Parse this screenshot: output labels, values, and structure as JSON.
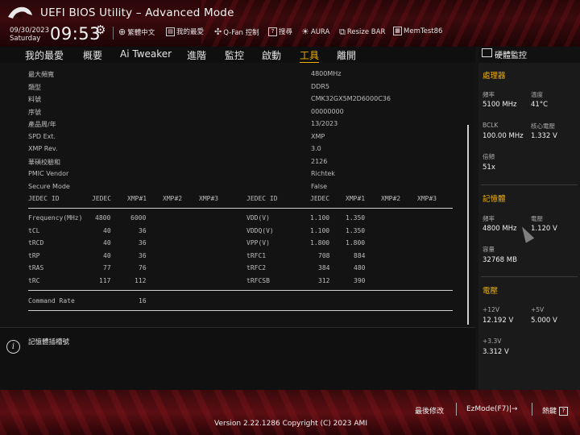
{
  "header": {
    "title": "UEFI BIOS Utility – Advanced Mode",
    "date": "09/30/2023",
    "weekday": "Saturday",
    "time": "09:53",
    "toolbar": [
      {
        "label": "繁體中文",
        "icon": "globe-icon"
      },
      {
        "label": "我的最愛",
        "icon": "favorites-icon"
      },
      {
        "label": "Q-Fan 控制",
        "icon": "fan-icon"
      },
      {
        "label": "搜尋",
        "icon": "search-help-icon"
      },
      {
        "label": "AURA",
        "icon": "aura-icon"
      },
      {
        "label": "Resize BAR",
        "icon": "resize-bar-icon"
      },
      {
        "label": "MemTest86",
        "icon": "memtest-icon"
      }
    ]
  },
  "menu": {
    "items": [
      "我的最愛",
      "概要",
      "Ai Tweaker",
      "進階",
      "監控",
      "啟動",
      "工具",
      "離開"
    ],
    "active": "工具"
  },
  "spd": {
    "fields": [
      {
        "label": "最大頻寬",
        "value": "4800MHz"
      },
      {
        "label": "類型",
        "value": "DDR5"
      },
      {
        "label": "料號",
        "value": "CMK32GX5M2D6000C36"
      },
      {
        "label": "序號",
        "value": "00000000"
      },
      {
        "label": "產品周/年",
        "value": "13/2023"
      },
      {
        "label": "SPD Ext.",
        "value": "XMP"
      },
      {
        "label": "XMP Rev.",
        "value": "3.0"
      },
      {
        "label": "華碩校驗和",
        "value": "2126"
      },
      {
        "label": "PMIC Vendor",
        "value": "Richtek"
      },
      {
        "label": "Secure Mode",
        "value": "False"
      }
    ],
    "left_headers": [
      "JEDEC ID",
      "JEDEC",
      "XMP#1",
      "XMP#2",
      "XMP#3"
    ],
    "right_headers": [
      "JEDEC ID",
      "JEDEC",
      "XMP#1",
      "XMP#2",
      "XMP#3"
    ],
    "left_rows": [
      [
        "Frequency(MHz)",
        "4800",
        "6000"
      ],
      [
        "tCL",
        "40",
        "36"
      ],
      [
        "tRCD",
        "40",
        "36"
      ],
      [
        "tRP",
        "40",
        "36"
      ],
      [
        "tRAS",
        "77",
        "76"
      ],
      [
        "tRC",
        "117",
        "112"
      ]
    ],
    "right_rows": [
      [
        "VDD(V)",
        "1.100",
        "1.350"
      ],
      [
        "VDDQ(V)",
        "1.100",
        "1.350"
      ],
      [
        "VPP(V)",
        "1.800",
        "1.800"
      ],
      [
        "tRFC1",
        "708",
        "884"
      ],
      [
        "tRFC2",
        "384",
        "480"
      ],
      [
        "tRFCSB",
        "312",
        "390"
      ]
    ],
    "command_rate": {
      "label": "Command Rate",
      "value": "16"
    }
  },
  "info": {
    "text": "記憶體插槽號"
  },
  "monitor": {
    "title": "硬體監控",
    "cpu": {
      "section": "處理器",
      "freq_label": "頻率",
      "freq": "5100 MHz",
      "temp_label": "溫度",
      "temp": "41°C",
      "bclk_label": "BCLK",
      "bclk": "100.00 MHz",
      "vcore_label": "核心電壓",
      "vcore": "1.332 V",
      "ratio_label": "倍頻",
      "ratio": "51x"
    },
    "memory": {
      "section": "記憶體",
      "freq_label": "頻率",
      "freq": "4800 MHz",
      "volt_label": "電壓",
      "volt": "1.120 V",
      "cap_label": "容量",
      "cap": "32768 MB"
    },
    "voltage": {
      "section": "電壓",
      "v12_label": "+12V",
      "v12": "12.192 V",
      "v5_label": "+5V",
      "v5": "5.000 V",
      "v33_label": "+3.3V",
      "v33": "3.312 V"
    }
  },
  "footer": {
    "last_modified": "最後修改",
    "ezmode": "EzMode(F7)|→",
    "hotkeys": "熱鍵",
    "version": "Version 2.22.1286 Copyright (C) 2023 AMI"
  }
}
